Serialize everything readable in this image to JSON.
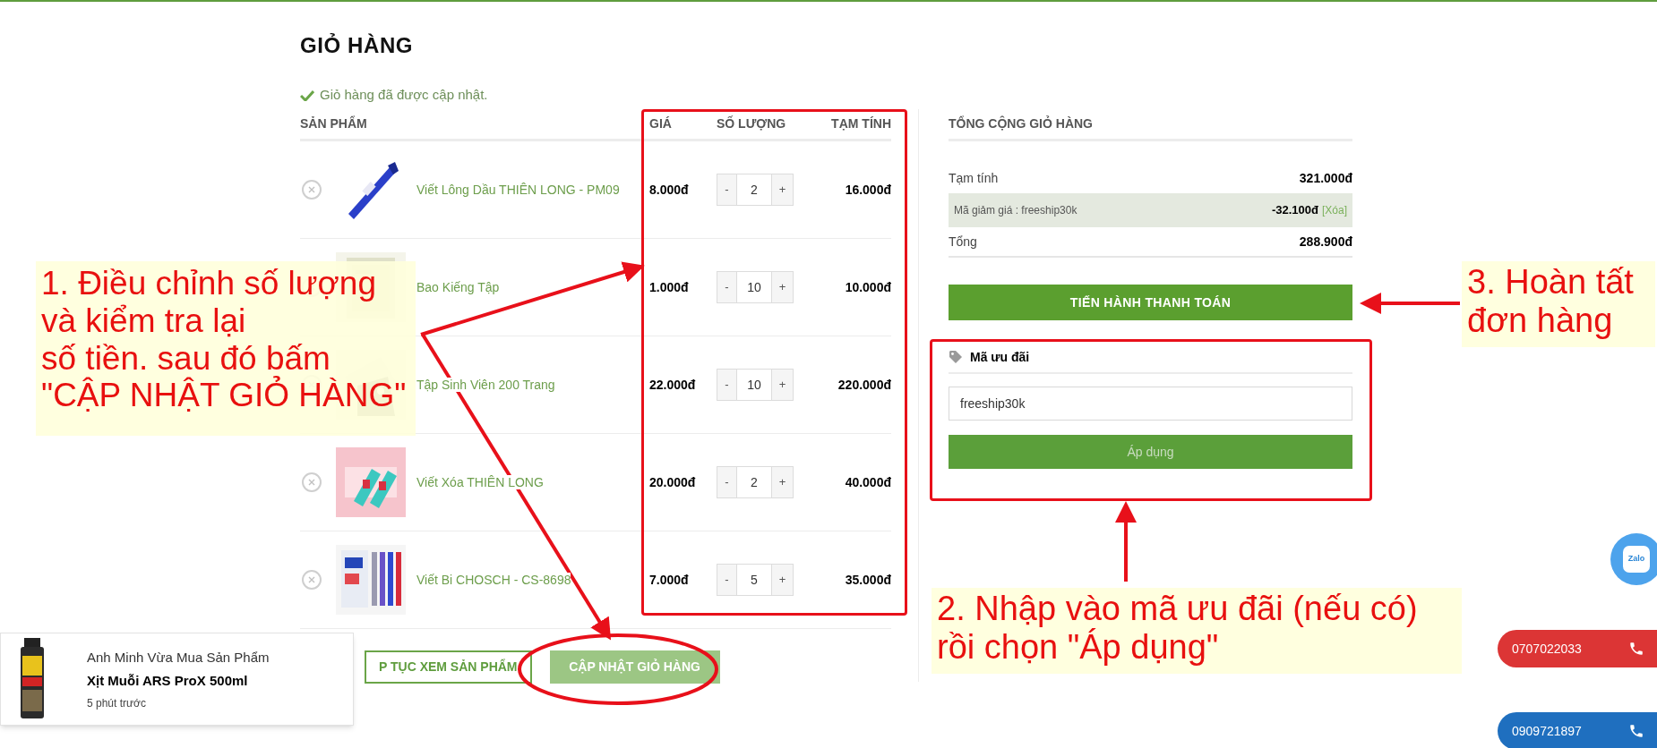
{
  "page_title": "GIỎ HÀNG",
  "notice": "Giỏ hàng đã được cập nhật.",
  "cart": {
    "columns": [
      "SẢN PHẨM",
      "GIÁ",
      "SỐ LƯỢNG",
      "TẠM TÍNH"
    ],
    "rows": [
      {
        "name": "Viết Lông Dầu THIÊN LONG - PM09",
        "price": "8.000đ",
        "minus": "-",
        "quantity": "2",
        "plus": "+",
        "subtotal": "16.000đ"
      },
      {
        "name": "Bao Kiếng Tập",
        "price": "1.000đ",
        "minus": "-",
        "quantity": "10",
        "plus": "+",
        "subtotal": "10.000đ"
      },
      {
        "name": "Tập Sinh Viên 200 Trang",
        "price": "22.000đ",
        "minus": "-",
        "quantity": "10",
        "plus": "+",
        "subtotal": "220.000đ"
      },
      {
        "name": "Viết Xóa THIÊN LONG",
        "price": "20.000đ",
        "minus": "-",
        "quantity": "2",
        "plus": "+",
        "subtotal": "40.000đ"
      },
      {
        "name": "Viết Bi CHOSCH - CS-8698",
        "price": "7.000đ",
        "minus": "-",
        "quantity": "5",
        "plus": "+",
        "subtotal": "35.000đ"
      }
    ],
    "continue_button": "P TỤC XEM SẢN PHẨM",
    "update_button": "CẬP NHẬT GIỎ HÀNG"
  },
  "totals": {
    "title": "TỔNG CỘNG GIỎ HÀNG",
    "rows": [
      {
        "kind": "subtotal",
        "label": "Tạm tính",
        "value": "321.000đ"
      },
      {
        "kind": "coupon",
        "label": "Mã giảm giá : freeship30k",
        "value": "-32.100đ",
        "action": "[Xóa]"
      },
      {
        "kind": "total",
        "label": "Tổng",
        "value": "288.900đ"
      }
    ],
    "checkout_button": "TIẾN HÀNH THANH TOÁN"
  },
  "coupon": {
    "title": "Mã ưu đãi",
    "value": "freeship30k",
    "apply_button": "Áp dụng"
  },
  "annotations": [
    {
      "lines": [
        "1. Điều chỉnh số lượng",
        "và kiểm tra lại",
        "số tiền. sau đó bấm",
        "\"CẬP NHẬT GIỎ HÀNG\""
      ]
    },
    {
      "lines": [
        "2. Nhập vào mã ưu đãi (nếu có)",
        "rồi chọn \"Áp dụng\""
      ]
    },
    {
      "lines": [
        "3. Hoàn tất",
        "đơn hàng"
      ]
    }
  ],
  "recent_purchase": {
    "headline": "Anh Minh Vừa Mua Sản Phẩm",
    "product": "Xịt Muỗi ARS ProX 500ml",
    "time": "5 phút trước"
  },
  "contacts": [
    {
      "kind": "zalo",
      "label": "Zalo"
    },
    {
      "kind": "phone",
      "number": "0707022033",
      "color": "#dc3535"
    },
    {
      "kind": "phone",
      "number": "0909721897",
      "color": "#1f6fbf"
    }
  ]
}
